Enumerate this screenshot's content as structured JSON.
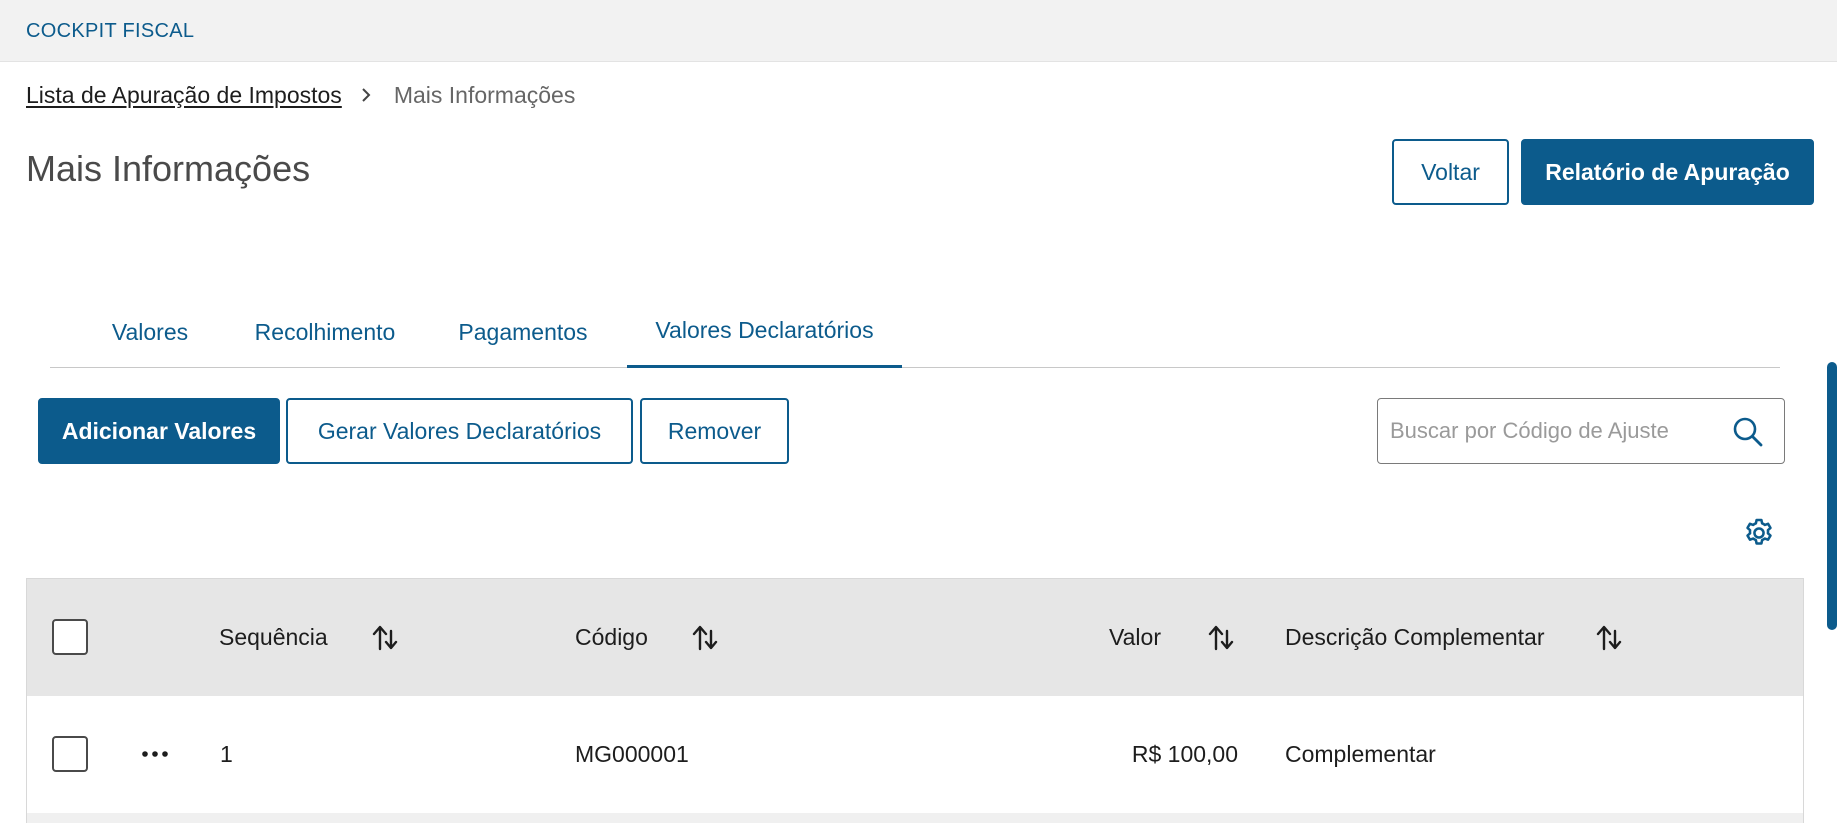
{
  "app": {
    "title": "COCKPIT FISCAL"
  },
  "breadcrumb": {
    "parent": "Lista de Apuração de Impostos",
    "current": "Mais Informações"
  },
  "page": {
    "title": "Mais Informações"
  },
  "header_actions": {
    "back_label": "Voltar",
    "report_label": "Relatório de Apuração"
  },
  "tabs": [
    {
      "label": "Valores",
      "active": false
    },
    {
      "label": "Recolhimento",
      "active": false
    },
    {
      "label": "Pagamentos",
      "active": false
    },
    {
      "label": "Valores Declaratórios",
      "active": true
    }
  ],
  "toolbar": {
    "add_label": "Adicionar Valores",
    "generate_label": "Gerar Valores Declaratórios",
    "remove_label": "Remover"
  },
  "search": {
    "placeholder": "Buscar por Código de Ajuste",
    "value": ""
  },
  "table": {
    "columns": [
      "Sequência",
      "Código",
      "Valor",
      "Descrição Complementar"
    ],
    "rows": [
      {
        "sequencia": "1",
        "codigo": "MG000001",
        "valor": "R$ 100,00",
        "descricao": "Complementar"
      }
    ]
  },
  "icons": {
    "chevron": "chevron-right-icon",
    "search": "search-icon",
    "settings": "gear-icon",
    "sort": "sort-arrows-icon",
    "more": "more-horizontal-icon"
  },
  "colors": {
    "primary": "#0c5b8c",
    "header_bg": "#f2f2f2",
    "table_header_bg": "#e6e6e6"
  }
}
